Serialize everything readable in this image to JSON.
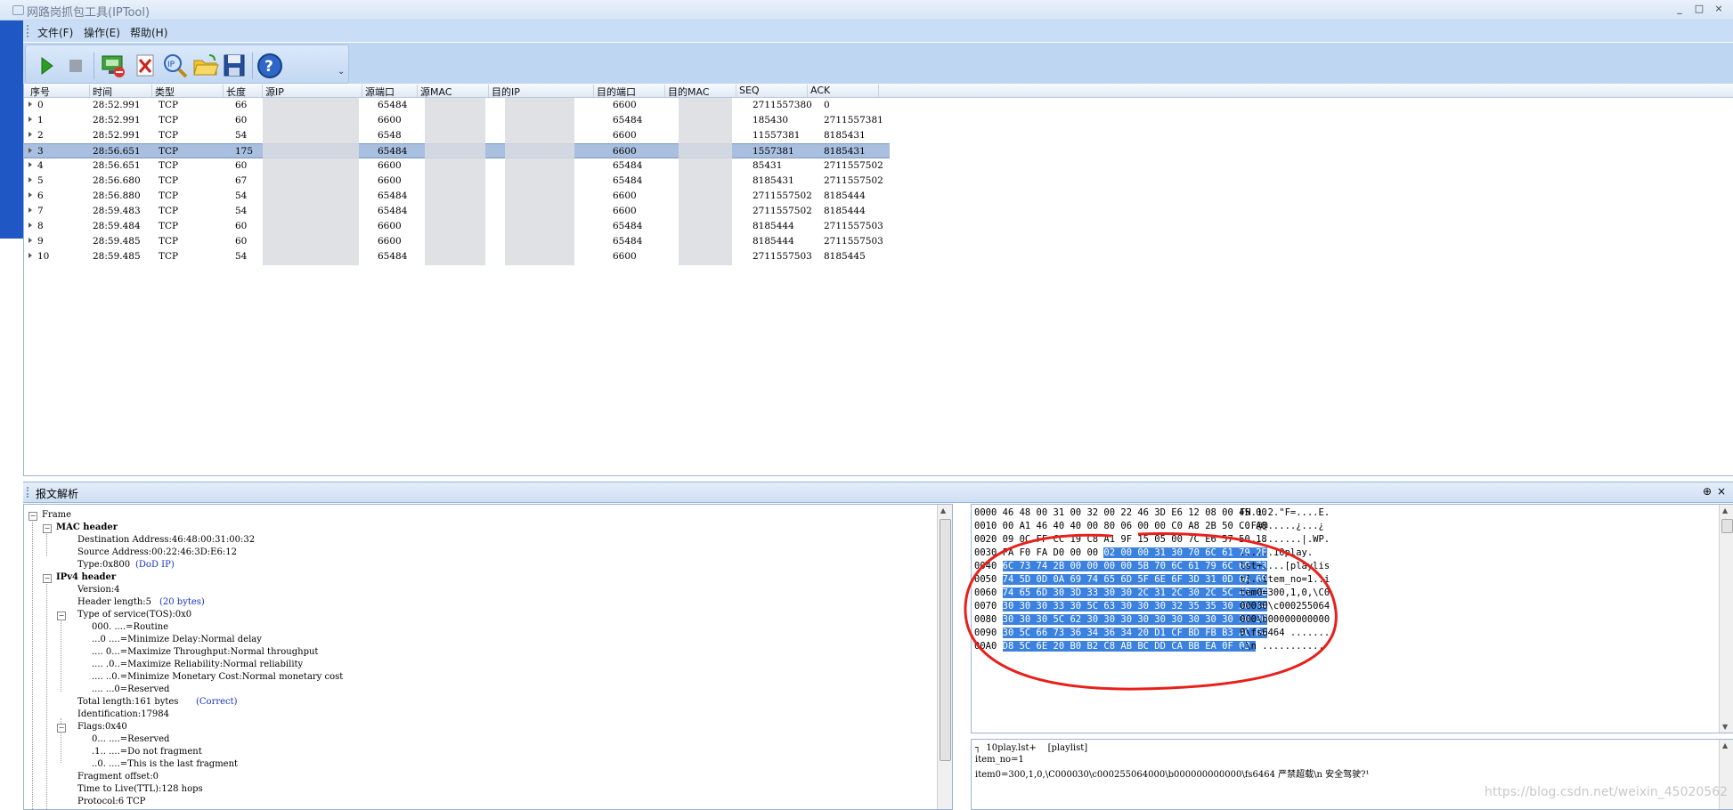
{
  "window": {
    "title": "网路岗抓包工具(IPTool)",
    "controls": [
      "_",
      "□",
      "×"
    ]
  },
  "menu": [
    "文件(F)",
    "操作(E)",
    "帮助(H)"
  ],
  "toolbar": {
    "buttons": [
      "play-icon",
      "stop-icon",
      "network-icon",
      "delete-icon",
      "ip-search-icon",
      "open-folder-icon",
      "save-icon",
      "help-icon"
    ],
    "more": "⌄"
  },
  "packet_list": {
    "headers": [
      "序号",
      "时间",
      "类型",
      "长度",
      "源IP",
      "源端口",
      "源MAC",
      "目的IP",
      "目的端口",
      "目的MAC",
      "SEQ",
      "ACK"
    ],
    "rows": [
      {
        "no": "0",
        "time": "28:52.991",
        "type": "TCP",
        "len": "66",
        "sport": "65484",
        "dport": "6600",
        "seq": "2711557380",
        "ack": "0"
      },
      {
        "no": "1",
        "time": "28:52.991",
        "type": "TCP",
        "len": "60",
        "sport": "6600",
        "dport": "65484",
        "seq": "185430",
        "ack": "2711557381"
      },
      {
        "no": "2",
        "time": "28:52.991",
        "type": "TCP",
        "len": "54",
        "sport": "6548",
        "dport": "6600",
        "seq": "11557381",
        "ack": "8185431"
      },
      {
        "no": "3",
        "time": "28:56.651",
        "type": "TCP",
        "len": "175",
        "sport": "65484",
        "dport": "6600",
        "seq": "1557381",
        "ack": "8185431"
      },
      {
        "no": "4",
        "time": "28:56.651",
        "type": "TCP",
        "len": "60",
        "sport": "6600",
        "dport": "65484",
        "seq": "85431",
        "ack": "2711557502"
      },
      {
        "no": "5",
        "time": "28:56.680",
        "type": "TCP",
        "len": "67",
        "sport": "6600",
        "dport": "65484",
        "seq": "8185431",
        "ack": "2711557502"
      },
      {
        "no": "6",
        "time": "28:56.880",
        "type": "TCP",
        "len": "54",
        "sport": "65484",
        "dport": "6600",
        "seq": "2711557502",
        "ack": "8185444"
      },
      {
        "no": "7",
        "time": "28:59.483",
        "type": "TCP",
        "len": "54",
        "sport": "65484",
        "dport": "6600",
        "seq": "2711557502",
        "ack": "8185444"
      },
      {
        "no": "8",
        "time": "28:59.484",
        "type": "TCP",
        "len": "60",
        "sport": "6600",
        "dport": "65484",
        "seq": "8185444",
        "ack": "2711557503"
      },
      {
        "no": "9",
        "time": "28:59.485",
        "type": "TCP",
        "len": "60",
        "sport": "6600",
        "dport": "65484",
        "seq": "8185444",
        "ack": "2711557503"
      },
      {
        "no": "10",
        "time": "28:59.485",
        "type": "TCP",
        "len": "54",
        "sport": "65484",
        "dport": "6600",
        "seq": "2711557503",
        "ack": "8185445"
      }
    ],
    "selected_index": 3
  },
  "detail": {
    "panel_title": "报文解析",
    "pin": "⊕",
    "close": "×",
    "tree": [
      "Frame",
      "MAC header",
      "Destination Address:46:48:00:31:00:32",
      "Source Address:00:22:46:3D:E6:12",
      "Type:0x800",
      "(DoD IP)",
      "IPv4 header",
      "Version:4",
      "Header length:5",
      "(20 bytes)",
      "Type of service(TOS):0x0",
      "000. ....=Routine",
      "...0 ....=Minimize Delay:Normal delay",
      ".... 0...=Maximize Throughput:Normal throughput",
      ".... .0..=Maximize Reliability:Normal reliability",
      ".... ..0.=Minimize Monetary Cost:Normal monetary cost",
      ".... ...0=Reserved",
      "Total length:161 bytes",
      "(Correct)",
      "Identification:17984",
      "Flags:0x40",
      "0... ....=Reserved",
      ".1.. ....=Do not fragment",
      "..0. ....=This is the last fragment",
      "Fragment offset:0",
      "Time to Live(TTL):128 hops",
      "Protocol:6 TCP"
    ]
  },
  "hex": {
    "lines": [
      {
        "off": "0000",
        "pre": "46 48 00 31 00 32 00 22 46 3D E6 12 08 00 45 00",
        "sel": "",
        "ascii": "FH.1.2.\"F=....E."
      },
      {
        "off": "0010",
        "pre": "00 A1 46 40 40 00 80 06 00 00 C0 A8 2B 50 C0 A8",
        "sel": "",
        "ascii": "..F@@.....¿...¿"
      },
      {
        "off": "0020",
        "pre": "09 0C FF CC 19 C8 A1 9F 15 05 00 7C E6 57 50 18",
        "sel": "",
        "ascii": "...........|.WP."
      },
      {
        "off": "0030",
        "pre": "FA F0 FA D0 00 00 ",
        "sel": "02 00 00 31 30 70 6C 61 79 2E",
        "ascii": "......10play."
      },
      {
        "off": "0040",
        "pre": "",
        "sel": "6C 73 74 2B 00 00 00 00 5B 70 6C 61 79 6C 69 73",
        "ascii": "lst+....[playlis"
      },
      {
        "off": "0050",
        "pre": "",
        "sel": "74 5D 0D 0A 69 74 65 6D 5F 6E 6F 3D 31 0D 0A 69",
        "ascii": "t]..item_no=1..i"
      },
      {
        "off": "0060",
        "pre": "",
        "sel": "74 65 6D 30 3D 33 30 30 2C 31 2C 30 2C 5C 43 30",
        "ascii": "tem0=300,1,0,\\C0"
      },
      {
        "off": "0070",
        "pre": "",
        "sel": "30 30 30 33 30 5C 63 30 30 30 32 35 35 30 36 34",
        "ascii": "00030\\c000255064"
      },
      {
        "off": "0080",
        "pre": "",
        "sel": "30 30 30 5C 62 30 30 30 30 30 30 30 30 30 30 30",
        "ascii": "000\\b00000000000"
      },
      {
        "off": "0090",
        "pre": "",
        "sel": "30 5C 66 73 36 34 36 34 20 D1 CF BD FB B3 AC D4",
        "ascii": "0\\fs6464 ......."
      },
      {
        "off": "00A0",
        "pre": "",
        "sel": "D8 5C 6E 20 B0 B2 C8 AB BC DD CA BB EA 0F 03 ",
        "ascii": ".\\n ..........."
      }
    ]
  },
  "text_view": {
    "lines": [
      "┐  10play.lst+    [playlist]",
      "item_no=1",
      "item0=300,1,0,\\C000030\\c000255064000\\b000000000000\\fs6464 严禁超载\\n 安全驾驶?¹"
    ]
  },
  "watermark": "https://blog.csdn.net/weixin_45020562",
  "colors": {
    "selection": "#a9bfe0",
    "hex_highlight": "#3b82e0",
    "annotation_circle": "#e8201c",
    "menu_bg": "#c9ddf6"
  }
}
